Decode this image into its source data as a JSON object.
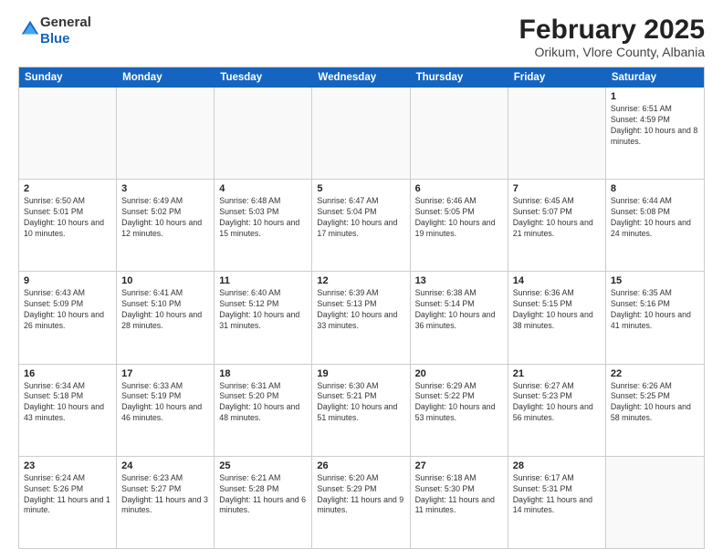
{
  "header": {
    "logo_general": "General",
    "logo_blue": "Blue",
    "month_year": "February 2025",
    "location": "Orikum, Vlore County, Albania"
  },
  "days_of_week": [
    "Sunday",
    "Monday",
    "Tuesday",
    "Wednesday",
    "Thursday",
    "Friday",
    "Saturday"
  ],
  "weeks": [
    [
      {
        "day": "",
        "info": ""
      },
      {
        "day": "",
        "info": ""
      },
      {
        "day": "",
        "info": ""
      },
      {
        "day": "",
        "info": ""
      },
      {
        "day": "",
        "info": ""
      },
      {
        "day": "",
        "info": ""
      },
      {
        "day": "1",
        "info": "Sunrise: 6:51 AM\nSunset: 4:59 PM\nDaylight: 10 hours and 8 minutes."
      }
    ],
    [
      {
        "day": "2",
        "info": "Sunrise: 6:50 AM\nSunset: 5:01 PM\nDaylight: 10 hours and 10 minutes."
      },
      {
        "day": "3",
        "info": "Sunrise: 6:49 AM\nSunset: 5:02 PM\nDaylight: 10 hours and 12 minutes."
      },
      {
        "day": "4",
        "info": "Sunrise: 6:48 AM\nSunset: 5:03 PM\nDaylight: 10 hours and 15 minutes."
      },
      {
        "day": "5",
        "info": "Sunrise: 6:47 AM\nSunset: 5:04 PM\nDaylight: 10 hours and 17 minutes."
      },
      {
        "day": "6",
        "info": "Sunrise: 6:46 AM\nSunset: 5:05 PM\nDaylight: 10 hours and 19 minutes."
      },
      {
        "day": "7",
        "info": "Sunrise: 6:45 AM\nSunset: 5:07 PM\nDaylight: 10 hours and 21 minutes."
      },
      {
        "day": "8",
        "info": "Sunrise: 6:44 AM\nSunset: 5:08 PM\nDaylight: 10 hours and 24 minutes."
      }
    ],
    [
      {
        "day": "9",
        "info": "Sunrise: 6:43 AM\nSunset: 5:09 PM\nDaylight: 10 hours and 26 minutes."
      },
      {
        "day": "10",
        "info": "Sunrise: 6:41 AM\nSunset: 5:10 PM\nDaylight: 10 hours and 28 minutes."
      },
      {
        "day": "11",
        "info": "Sunrise: 6:40 AM\nSunset: 5:12 PM\nDaylight: 10 hours and 31 minutes."
      },
      {
        "day": "12",
        "info": "Sunrise: 6:39 AM\nSunset: 5:13 PM\nDaylight: 10 hours and 33 minutes."
      },
      {
        "day": "13",
        "info": "Sunrise: 6:38 AM\nSunset: 5:14 PM\nDaylight: 10 hours and 36 minutes."
      },
      {
        "day": "14",
        "info": "Sunrise: 6:36 AM\nSunset: 5:15 PM\nDaylight: 10 hours and 38 minutes."
      },
      {
        "day": "15",
        "info": "Sunrise: 6:35 AM\nSunset: 5:16 PM\nDaylight: 10 hours and 41 minutes."
      }
    ],
    [
      {
        "day": "16",
        "info": "Sunrise: 6:34 AM\nSunset: 5:18 PM\nDaylight: 10 hours and 43 minutes."
      },
      {
        "day": "17",
        "info": "Sunrise: 6:33 AM\nSunset: 5:19 PM\nDaylight: 10 hours and 46 minutes."
      },
      {
        "day": "18",
        "info": "Sunrise: 6:31 AM\nSunset: 5:20 PM\nDaylight: 10 hours and 48 minutes."
      },
      {
        "day": "19",
        "info": "Sunrise: 6:30 AM\nSunset: 5:21 PM\nDaylight: 10 hours and 51 minutes."
      },
      {
        "day": "20",
        "info": "Sunrise: 6:29 AM\nSunset: 5:22 PM\nDaylight: 10 hours and 53 minutes."
      },
      {
        "day": "21",
        "info": "Sunrise: 6:27 AM\nSunset: 5:23 PM\nDaylight: 10 hours and 56 minutes."
      },
      {
        "day": "22",
        "info": "Sunrise: 6:26 AM\nSunset: 5:25 PM\nDaylight: 10 hours and 58 minutes."
      }
    ],
    [
      {
        "day": "23",
        "info": "Sunrise: 6:24 AM\nSunset: 5:26 PM\nDaylight: 11 hours and 1 minute."
      },
      {
        "day": "24",
        "info": "Sunrise: 6:23 AM\nSunset: 5:27 PM\nDaylight: 11 hours and 3 minutes."
      },
      {
        "day": "25",
        "info": "Sunrise: 6:21 AM\nSunset: 5:28 PM\nDaylight: 11 hours and 6 minutes."
      },
      {
        "day": "26",
        "info": "Sunrise: 6:20 AM\nSunset: 5:29 PM\nDaylight: 11 hours and 9 minutes."
      },
      {
        "day": "27",
        "info": "Sunrise: 6:18 AM\nSunset: 5:30 PM\nDaylight: 11 hours and 11 minutes."
      },
      {
        "day": "28",
        "info": "Sunrise: 6:17 AM\nSunset: 5:31 PM\nDaylight: 11 hours and 14 minutes."
      },
      {
        "day": "",
        "info": ""
      }
    ]
  ]
}
